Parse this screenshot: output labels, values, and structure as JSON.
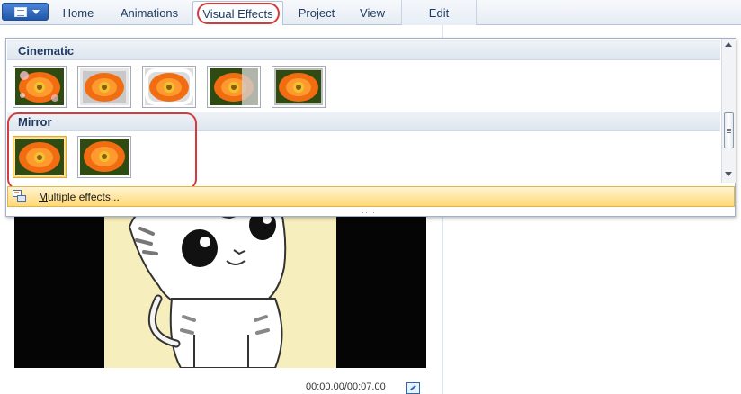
{
  "ribbon": {
    "tabs": [
      {
        "label": "Home"
      },
      {
        "label": "Animations"
      },
      {
        "label": "Visual Effects"
      },
      {
        "label": "Project"
      },
      {
        "label": "View"
      },
      {
        "label": "Edit"
      }
    ],
    "active_tab": "Visual Effects"
  },
  "gallery": {
    "sections": [
      {
        "title": "Cinematic",
        "thumbnail_count": 5
      },
      {
        "title": "Mirror",
        "thumbnail_count": 2,
        "selected_index": 0
      }
    ],
    "multiple_effects": {
      "label_accel": "M",
      "label_rest": "ultiple effects..."
    }
  },
  "player": {
    "timecode": "00:00.00/00:07.00"
  },
  "colors": {
    "highlight_red": "#d23c3c",
    "selection_gold": "#e3a936",
    "ribbon_blue": "#1f56a8"
  }
}
